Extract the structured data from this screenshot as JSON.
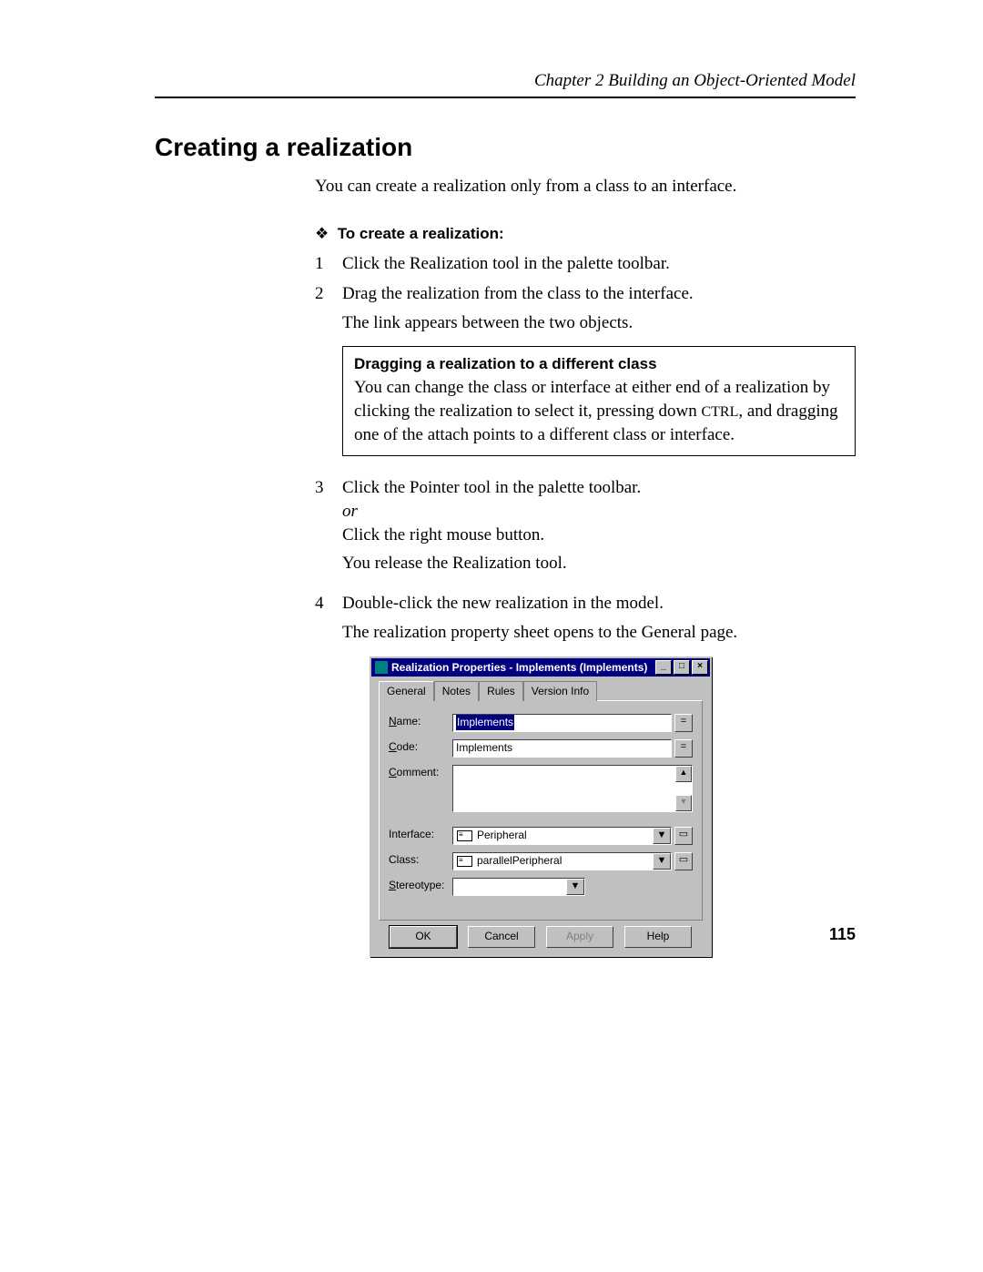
{
  "header": {
    "chapter_line": "Chapter 2  Building an Object-Oriented Model"
  },
  "title": "Creating a realization",
  "intro": "You can create a realization only from a class to an interface.",
  "subhead": "To create a realization:",
  "steps": {
    "n1": "1",
    "s1": "Click the Realization tool in the palette toolbar.",
    "n2": "2",
    "s2": "Drag the realization from the class to the interface.",
    "s2b": "The link appears between the two objects.",
    "n3": "3",
    "s3a": "Click the Pointer tool in the palette toolbar.",
    "s3or": "or",
    "s3b": "Click the right mouse button.",
    "s3c": "You release the Realization tool.",
    "n4": "4",
    "s4": "Double-click the new realization in the model.",
    "s4b": "The realization property sheet opens to the General page."
  },
  "note": {
    "title": "Dragging a realization to a different class",
    "body_pre": "You can change the class or interface at either end of a realization by clicking the realization to select it, pressing down ",
    "ctrl": "CTRL",
    "body_post": ", and dragging one of the attach points to a different class or interface."
  },
  "dialog": {
    "title": "Realization Properties - Implements (Implements)",
    "tabs": [
      "General",
      "Notes",
      "Rules",
      "Version Info"
    ],
    "labels": {
      "name_u": "N",
      "name_rest": "ame:",
      "code_u": "C",
      "code_rest": "ode:",
      "comment_u": "C",
      "comment_rest": "omment:",
      "interface": "Interface:",
      "class": "Class:",
      "stereo_u": "S",
      "stereo_rest": "tereotype:"
    },
    "values": {
      "name": "Implements",
      "code": "Implements",
      "interface": "Peripheral",
      "class": "parallelPeripheral",
      "stereotype": ""
    },
    "buttons": {
      "ok": "OK",
      "cancel": "Cancel",
      "apply_u": "A",
      "apply_rest": "pply",
      "help": "Help"
    }
  },
  "pagenum": "115"
}
